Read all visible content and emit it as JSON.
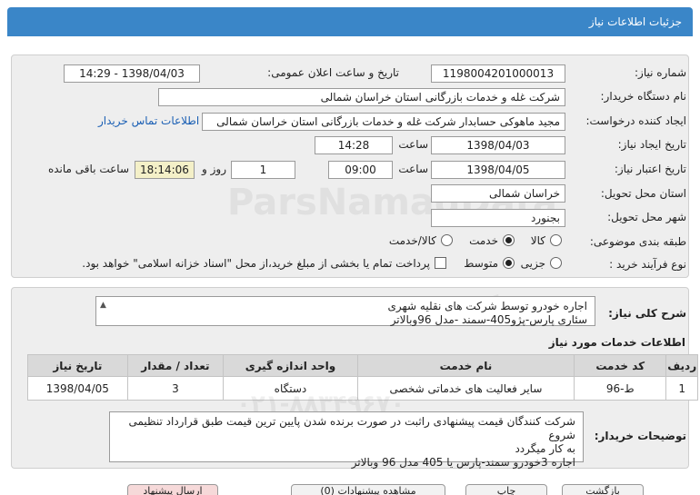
{
  "header": {
    "title": "جزئیات اطلاعات نیاز"
  },
  "form": {
    "need_number": {
      "label": "شماره نیاز:",
      "value": "1198004201000013"
    },
    "announce": {
      "label": "تاریخ و ساعت اعلان عمومی:",
      "value": "1398/04/03 - 14:29"
    },
    "buyer": {
      "label": "نام دستگاه خریدار:",
      "value": "شرکت غله و خدمات بازرگانی استان خراسان شمالی"
    },
    "requester": {
      "label": "ایجاد کننده درخواست:",
      "value": "مجید ماهوکی حسابدار شرکت غله و خدمات بازرگانی استان خراسان شمالی",
      "contact_link": "اطلاعات تماس خریدار"
    },
    "created": {
      "label": "تاریخ ایجاد نیاز:",
      "date": "1398/04/03",
      "time_label": "ساعت",
      "time": "14:28"
    },
    "validity": {
      "label": "تاریخ اعتبار نیاز:",
      "date": "1398/04/05",
      "time_label": "ساعت",
      "time": "09:00",
      "days": "1",
      "days_label": "روز و",
      "remaining": "18:14:06",
      "remaining_label": "ساعت باقی مانده"
    },
    "province": {
      "label": "استان محل تحویل:",
      "value": "خراسان شمالی"
    },
    "city": {
      "label": "شهر محل تحویل:",
      "value": "بجنورد"
    },
    "category": {
      "label": "طبقه بندی موضوعی:",
      "options": [
        "کالا",
        "خدمت",
        "کالا/خدمت"
      ],
      "selected": "خدمت"
    },
    "process": {
      "label": "نوع فرآیند خرید :",
      "options": [
        "جزیی",
        "متوسط"
      ],
      "selected": "متوسط",
      "payment_note": "پرداخت تمام یا بخشی از مبلغ خرید،از محل \"اسناد خزانه اسلامی\" خواهد بود."
    }
  },
  "summary": {
    "label": "شرح کلی نیاز:",
    "lines": [
      "اجاره خودرو توسط شرکت های نقلیه شهری",
      "سئاری پارس-پژو405-سمند -مدل 96وبالاتر"
    ]
  },
  "services": {
    "title": "اطلاعات خدمات مورد نیاز",
    "columns": [
      "ردیف",
      "کد خدمت",
      "نام خدمت",
      "واحد اندازه گیری",
      "تعداد / مقدار",
      "تاریخ نیاز"
    ],
    "rows": [
      [
        "1",
        "ط-96",
        "سایر فعالیت های خدماتی شخصی",
        "دستگاه",
        "3",
        "1398/04/05"
      ]
    ]
  },
  "notes": {
    "label": "توضیحات خریدار:",
    "lines": [
      "شرکت کنندگان قیمت پیشنهادی راثبت در صورت برنده شدن پایین ترین قیمت طبق قرارداد تنظیمی شروع",
      "به کار میگردد",
      "اجاره 3خودرو سمند-پارس یا 405 مدل 96 وبالاتر"
    ]
  },
  "footer_buttons": [
    "بازگشت",
    "چاپ",
    "مشاهده پیشنهادات (0)",
    "ارسال پیشنهاد"
  ],
  "colors": {
    "header": "#3a86c8",
    "panel": "#eeeeee",
    "remaining_bg": "#f4f0c8",
    "link": "#1a5fb4"
  }
}
